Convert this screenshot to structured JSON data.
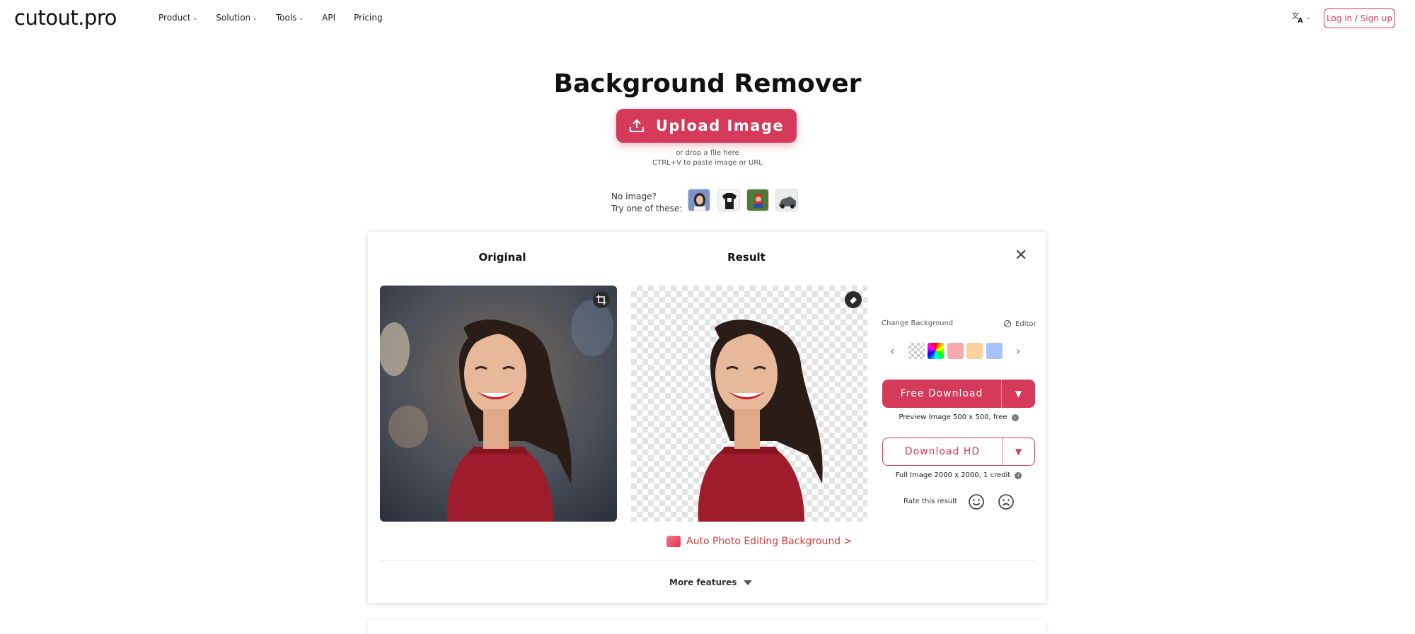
{
  "brand": {
    "logo_text": "cutout.pro"
  },
  "nav": {
    "items": [
      {
        "label": "Product",
        "has_dropdown": true
      },
      {
        "label": "Solution",
        "has_dropdown": true
      },
      {
        "label": "Tools",
        "has_dropdown": true
      },
      {
        "label": "API",
        "has_dropdown": false
      },
      {
        "label": "Pricing",
        "has_dropdown": false
      }
    ],
    "language_icon": "translate-icon",
    "login_label": "Log in / Sign up"
  },
  "hero": {
    "title": "Background Remover",
    "upload_label": "Upload Image",
    "drop_hint": "or drop a file here",
    "paste_hint": "CTRL+V to paste image or URL",
    "no_image": "No image?",
    "try_these": "Try one of these:"
  },
  "workspace": {
    "original_label": "Original",
    "result_label": "Result",
    "change_background_label": "Change Background",
    "editor_label": "Editor",
    "swatches": [
      "transparent",
      "rainbow",
      "#f4a9ad",
      "#fbd29b",
      "#a8c3fb"
    ],
    "free_download_label": "Free Download",
    "preview_info": "Preview Image 500 x 500, free",
    "download_hd_label": "Download HD",
    "full_info": "Full Image 2000 x 2000, 1 credit",
    "rate_label": "Rate this result",
    "auto_edit_label": "Auto Photo Editing Background >",
    "more_features_label": "More features"
  },
  "colors": {
    "accent": "#d63a5a",
    "link": "#d63a3a"
  }
}
